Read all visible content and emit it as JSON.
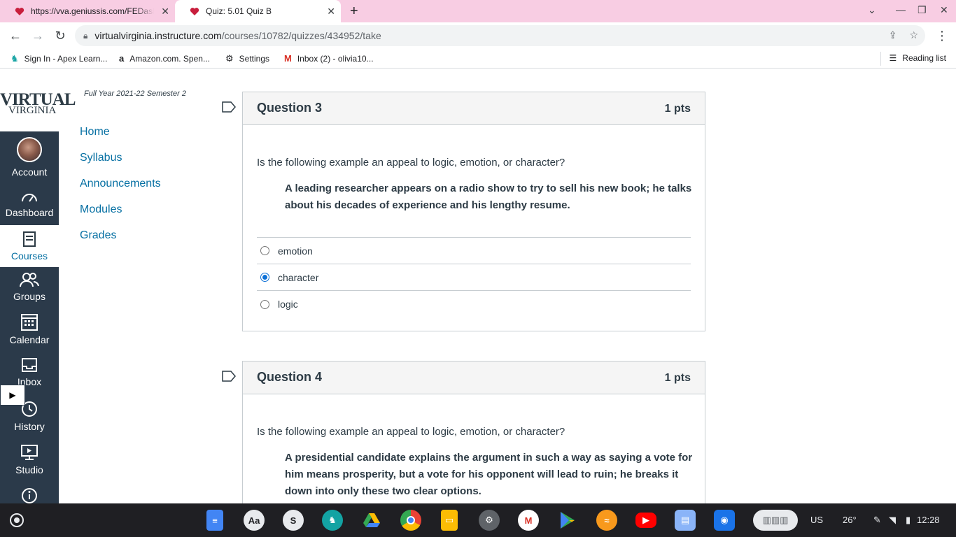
{
  "browser": {
    "tabs": [
      {
        "title": "https://vva.geniussis.com/FEDashboard",
        "active": false
      },
      {
        "title": "Quiz: 5.01 Quiz B",
        "active": true
      }
    ],
    "url_host": "virtualvirginia.instructure.com",
    "url_path": "/courses/10782/quizzes/434952/take",
    "bookmarks": [
      {
        "label": "Sign In - Apex Learn...",
        "icon": "apex-icon"
      },
      {
        "label": "Amazon.com. Spen...",
        "icon": "amazon-icon"
      },
      {
        "label": "Settings",
        "icon": "gear-icon"
      },
      {
        "label": "Inbox (2) - olivia10...",
        "icon": "gmail-icon"
      }
    ],
    "reading_list": "Reading list"
  },
  "logo": {
    "line1": "VIRTUAL",
    "line2": "VIRGINIA"
  },
  "term": "Full Year 2021-22 Semester 2",
  "global_nav": [
    {
      "label": "Account",
      "icon": "avatar"
    },
    {
      "label": "Dashboard",
      "icon": "dashboard-icon"
    },
    {
      "label": "Courses",
      "icon": "courses-icon",
      "active": true
    },
    {
      "label": "Groups",
      "icon": "groups-icon"
    },
    {
      "label": "Calendar",
      "icon": "calendar-icon"
    },
    {
      "label": "Inbox",
      "icon": "inbox-icon"
    },
    {
      "label": "History",
      "icon": "history-icon"
    },
    {
      "label": "Studio",
      "icon": "studio-icon"
    }
  ],
  "course_nav": [
    "Home",
    "Syllabus",
    "Announcements",
    "Modules",
    "Grades"
  ],
  "questions": [
    {
      "name": "Question 3",
      "points": "1 pts",
      "text": "Is the following example an appeal to logic, emotion, or character?",
      "example": "A leading researcher appears on a radio show to try to sell his new book; he talks about his decades of experience and his lengthy resume.",
      "answers": [
        {
          "label": "emotion",
          "selected": false
        },
        {
          "label": "character",
          "selected": true
        },
        {
          "label": "logic",
          "selected": false
        }
      ]
    },
    {
      "name": "Question 4",
      "points": "1 pts",
      "text": "Is the following example an appeal to logic, emotion, or character?",
      "example": "A presidential candidate explains the argument in such a way as saying a vote for him means prosperity, but a vote for his opponent will lead to ruin; he breaks it down into only these two clear options."
    }
  ],
  "shelf": {
    "apps": [
      "docs-icon",
      "font-icon",
      "skype-icon",
      "pinterest-icon",
      "drive-icon",
      "chrome-icon",
      "slides-icon",
      "settings-icon",
      "gmail-icon",
      "play-store-icon",
      "audible-icon",
      "youtube-icon",
      "files-icon",
      "camera-icon"
    ],
    "ime": "US",
    "temperature": "26°",
    "time": "12:28"
  },
  "colors": {
    "tab_bar": "#f8cde3",
    "global_nav": "#2b3a4a",
    "link": "#0770a3",
    "question_header": "#f5f5f5"
  }
}
